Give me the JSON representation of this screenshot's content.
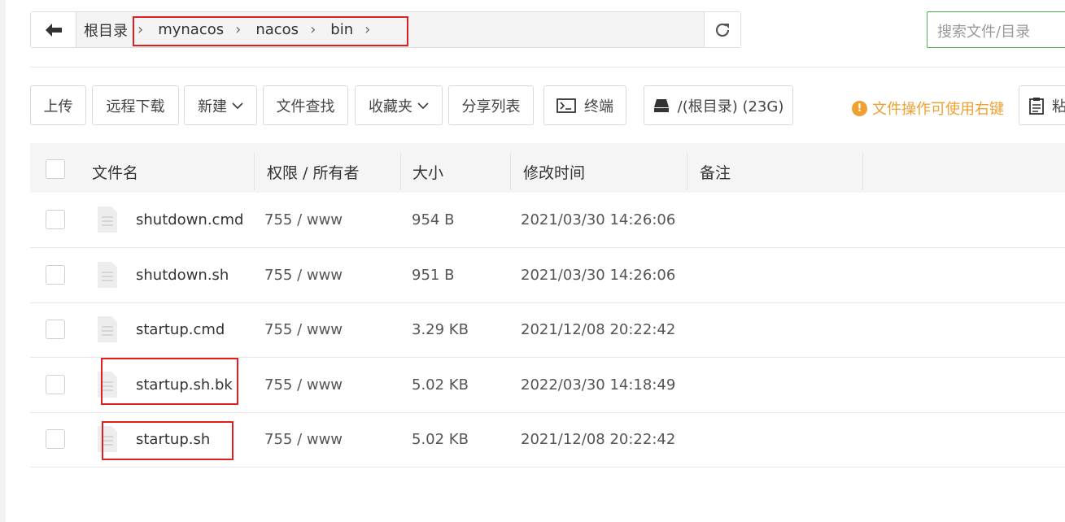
{
  "breadcrumb": {
    "root": "根目录",
    "segments": [
      "mynacos",
      "nacos",
      "bin"
    ]
  },
  "search": {
    "placeholder": "搜索文件/目录"
  },
  "toolbar": {
    "upload": "上传",
    "remote_download": "远程下载",
    "new": "新建",
    "file_search": "文件查找",
    "favorites": "收藏夹",
    "share_list": "分享列表",
    "terminal": "终端",
    "disk": "/(根目录) (23G)",
    "tip": "文件操作可使用右键",
    "paste": "粘"
  },
  "table": {
    "headers": [
      "文件名",
      "权限 / 所有者",
      "大小",
      "修改时间",
      "备注"
    ],
    "rows": [
      {
        "name": "shutdown.cmd",
        "perm": "755 / www",
        "size": "954 B",
        "mtime": "2021/03/30 14:26:06",
        "note": ""
      },
      {
        "name": "shutdown.sh",
        "perm": "755 / www",
        "size": "951 B",
        "mtime": "2021/03/30 14:26:06",
        "note": ""
      },
      {
        "name": "startup.cmd",
        "perm": "755 / www",
        "size": "3.29 KB",
        "mtime": "2021/12/08 20:22:42",
        "note": ""
      },
      {
        "name": "startup.sh.bk",
        "perm": "755 / www",
        "size": "5.02 KB",
        "mtime": "2022/03/30 14:18:49",
        "note": ""
      },
      {
        "name": "startup.sh",
        "perm": "755 / www",
        "size": "5.02 KB",
        "mtime": "2021/12/08 20:22:42",
        "note": ""
      }
    ]
  },
  "colors": {
    "highlight": "#e02020",
    "tip": "#f0a030",
    "search_border": "#4caf50"
  }
}
